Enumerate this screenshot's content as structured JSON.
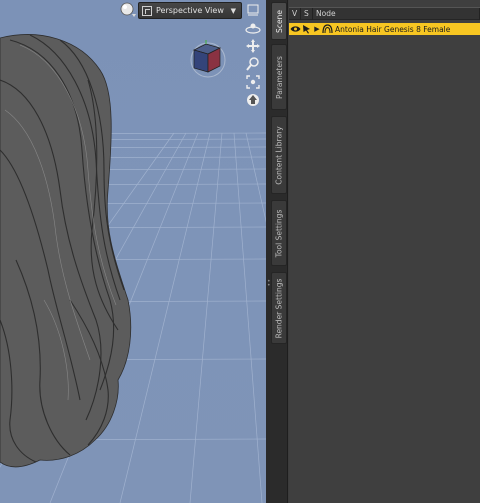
{
  "viewport": {
    "view_dropdown": {
      "label": "Perspective View"
    },
    "nav_tools": [
      "align-icon",
      "orbit-icon",
      "pan-icon",
      "zoom-icon",
      "frame-icon",
      "home-icon"
    ],
    "colors": {
      "background": "#7e94b8",
      "grid": "#9fb2cf",
      "hair": "#5b5b5b"
    }
  },
  "tabs": [
    {
      "label": "Scene",
      "active": true
    },
    {
      "label": "Parameters",
      "active": false
    },
    {
      "label": "Content Library",
      "active": false
    },
    {
      "label": "Tool Settings",
      "active": false
    },
    {
      "label": "Render Settings",
      "active": false
    }
  ],
  "scene": {
    "columns": {
      "visible": "V",
      "selectable": "S",
      "node": "Node"
    },
    "rows": [
      {
        "label": "Antonia Hair Genesis 8 Female",
        "selected": true,
        "highlight": "#f7c622"
      }
    ]
  }
}
